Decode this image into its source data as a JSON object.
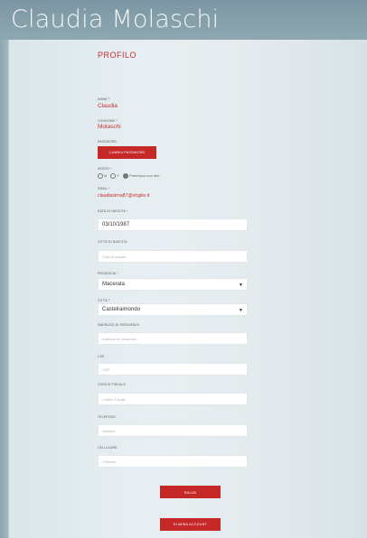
{
  "header": {
    "name": "Claudia Molaschi"
  },
  "profile": {
    "title": "PROFILO",
    "nome": {
      "label": "NOME *",
      "value": "Claudia"
    },
    "cognome": {
      "label": "COGNOME *",
      "value": "Molaschi"
    },
    "password": {
      "label": "PASSWORD",
      "button": "CAMBIA PASSWORD"
    },
    "sesso": {
      "label": "SESSO *",
      "options": [
        "M",
        "F",
        "Preferisco non dire"
      ],
      "selected": "Preferisco non dire"
    },
    "email": {
      "label": "EMAIL *",
      "value": "claudiasirna87@virgilio.it"
    },
    "data_nascita": {
      "label": "DATA DI NASCITA *",
      "value": "03/10/1987"
    },
    "citta_nascita": {
      "label": "CITTÀ DI NASCITA",
      "placeholder": "Città di nascita"
    },
    "provincia": {
      "label": "PROVINCIA *",
      "value": "Macerata"
    },
    "citta": {
      "label": "CITTÀ *",
      "value": "Castelraimondo"
    },
    "indirizzo": {
      "label": "INDIRIZZO DI RESIDENZA",
      "placeholder": "Indirizzo di residenza"
    },
    "cap": {
      "label": "CAP",
      "placeholder": "CAP"
    },
    "codice_fiscale": {
      "label": "CODICE FISCALE",
      "placeholder": "Codice Fiscale"
    },
    "telefono": {
      "label": "TELEFONO",
      "placeholder": "Numero"
    },
    "cellulare": {
      "label": "CELLULARE",
      "placeholder": "Cellulare"
    },
    "save_button": "SALVA",
    "delete_button": "ELIMINA ACCOUNT"
  },
  "colors": {
    "accent": "#c62828",
    "header": "#8ea7b2"
  },
  "icons": {
    "select_arrow": "triangle-down-icon"
  }
}
